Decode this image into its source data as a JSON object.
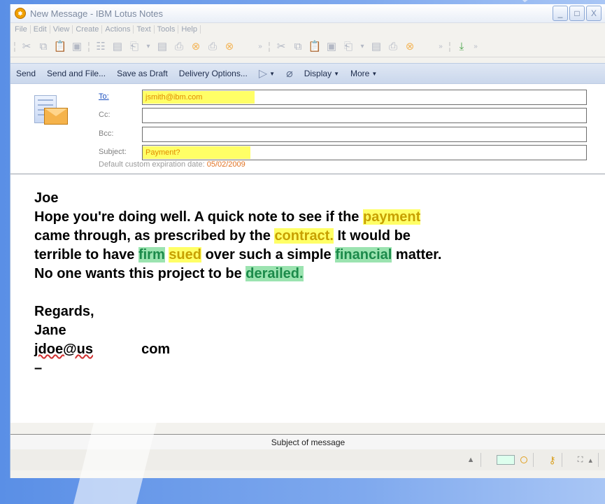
{
  "window": {
    "title": "New Message - IBM Lotus Notes",
    "controls": [
      "_",
      "□",
      "X"
    ]
  },
  "menu": [
    "File",
    "Edit",
    "View",
    "Create",
    "Actions",
    "Text",
    "Tools",
    "Help"
  ],
  "actions": {
    "send": "Send",
    "send_file": "Send and File...",
    "save_draft": "Save as Draft",
    "delivery": "Delivery Options...",
    "display": "Display",
    "more": "More"
  },
  "header": {
    "to_label": "To:",
    "to_value": "jsmith@ibm.com",
    "cc_label": "Cc:",
    "bcc_label": "Bcc:",
    "subject_label": "Subject:",
    "subject_value": "Payment?",
    "expiry_label": "Default custom expiration date:",
    "expiry_date": "05/02/2009"
  },
  "body": {
    "greeting": "Joe",
    "l1a": "Hope you're doing well. A quick note to see if the",
    "l1b": "payment",
    "l2a": "came through, as prescribed by the",
    "l2b": "contract.",
    "l2c": "It would be",
    "l3a": "terrible to have",
    "l3b": "firm",
    "l3c": "sued",
    "l3d": "over such a simple",
    "l3e": "financial",
    "l3f": "matter.",
    "l4a": "No one wants this project to be",
    "l4b": "derailed.",
    "regards": "Regards,",
    "name": "Jane",
    "email_a": "jdoe@us",
    "email_b": "com",
    "dash": "–"
  },
  "status": {
    "hint": "Subject of message"
  },
  "colors": {
    "highlight_yellow": "#ffff66",
    "highlight_green": "#9be3b0",
    "accent": "#1a4fbf"
  }
}
